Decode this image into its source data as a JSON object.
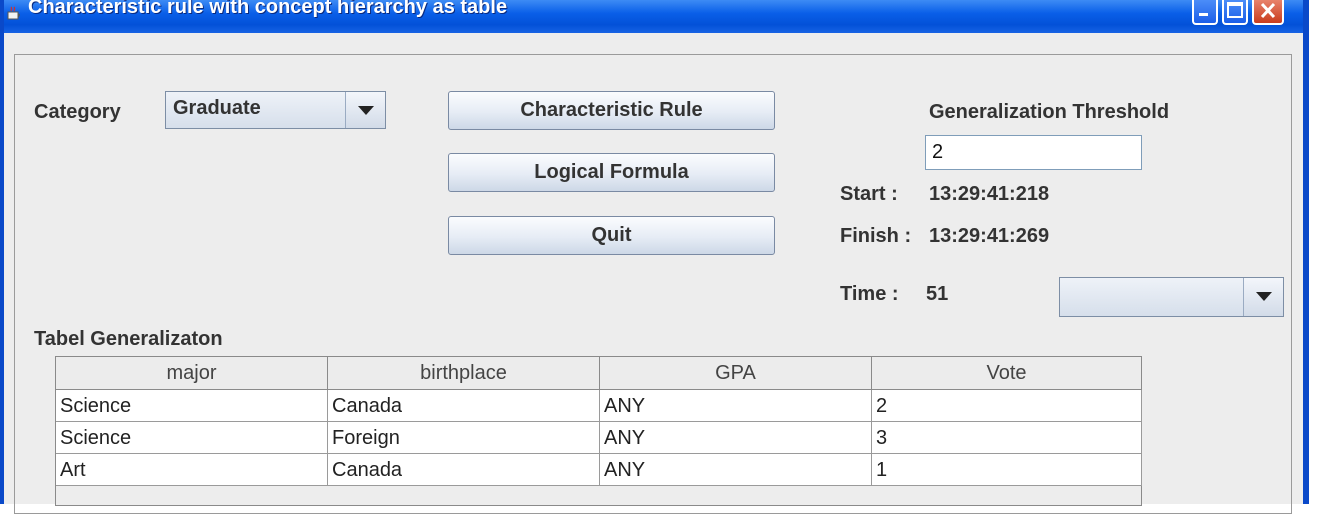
{
  "window": {
    "title": "Characteristic rule with concept hierarchy as table"
  },
  "form": {
    "category_label": "Category",
    "category_value": "Graduate",
    "buttons": {
      "characteristic_rule": "Characteristic Rule",
      "logical_formula": "Logical Formula",
      "quit": "Quit"
    },
    "threshold_label": "Generalization Threshold",
    "threshold_value": "2",
    "start_label": "Start  :",
    "start_value": "13:29:41:218",
    "finish_label": "Finish :",
    "finish_value": "13:29:41:269",
    "time_label": "Time :",
    "time_value": "51",
    "time_select_value": ""
  },
  "table": {
    "title": "Tabel Generalizaton",
    "columns": [
      "major",
      "birthplace",
      "GPA",
      "Vote"
    ],
    "rows": [
      [
        "Science",
        "Canada",
        "ANY",
        "2"
      ],
      [
        "Science",
        "Foreign",
        "ANY",
        "3"
      ],
      [
        "Art",
        "Canada",
        "ANY",
        "1"
      ]
    ]
  }
}
